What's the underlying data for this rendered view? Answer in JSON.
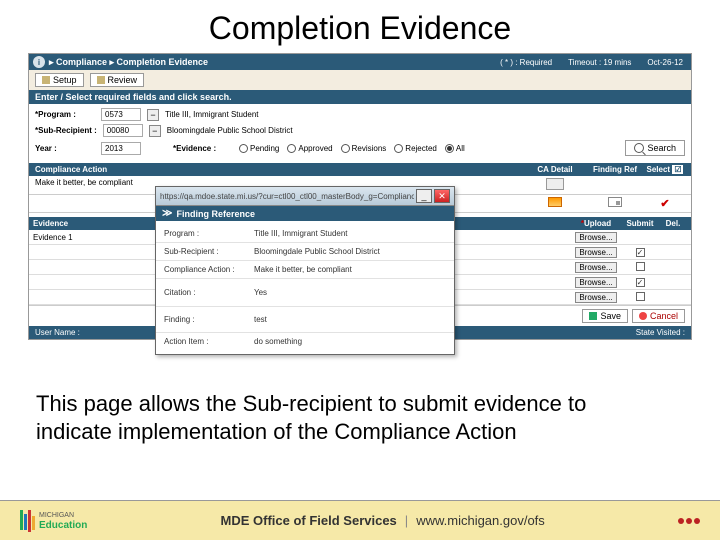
{
  "slide": {
    "title": "Completion Evidence"
  },
  "breadcrumb": {
    "path": "▸ Compliance ▸ Completion Evidence",
    "required_marker": "( * ) : Required",
    "timeout": "Timeout : 19 mins",
    "date": "Oct-26-12"
  },
  "top_buttons": {
    "setup": "Setup",
    "review": "Review"
  },
  "search": {
    "header": "Enter / Select required fields and click search.",
    "program_label": "*Program :",
    "program_code": "0573",
    "program_desc": "Title III, Immigrant Student",
    "sub_label": "*Sub-Recipient :",
    "sub_code": "00080",
    "sub_desc": "Bloomingdale Public School District",
    "year_label": "Year :",
    "year_val": "2013",
    "evidence_label": "*Evidence :",
    "r1": "Pending",
    "r2": "Approved",
    "r3": "Revisions",
    "r4": "Rejected",
    "r5": "All",
    "search_btn": "Search"
  },
  "ca": {
    "h1": "Compliance Action",
    "h2": "CA Detail",
    "h3": "Finding Ref",
    "h4": "Select",
    "row1_text": "Make it better, be compliant"
  },
  "popup": {
    "url": "https://qa.mdoe.state.mi.us/?cur=ctl00_ctl00_masterBody_g=Compliance_ctl...",
    "header": "Finding Reference",
    "program_label": "Program :",
    "program_val": "Title III, Immigrant Student",
    "sub_label": "Sub-Recipient :",
    "sub_val": "Bloomingdale Public School District",
    "ca_label": "Compliance Action :",
    "ca_val": "Make it better, be compliant",
    "citation_label": "Citation :",
    "citation_val": "Yes",
    "finding_label": "Finding :",
    "finding_val": "test",
    "action_label": "Action Item :",
    "action_val": "do something"
  },
  "evidence": {
    "h1": "Evidence",
    "h2": "",
    "h3": "Upload",
    "h4": "Submit",
    "h5": "Del.",
    "row1_label": "Evidence 1",
    "browse": "Browse..."
  },
  "save_cancel": {
    "save": "Save",
    "cancel": "Cancel"
  },
  "footer_bar": {
    "user": "User Name :",
    "visit": "State Visited :"
  },
  "caption": "This page allows the Sub-recipient to submit evidence to indicate implementation of the Compliance Action",
  "slide_footer": {
    "logo_small": "MICHIGAN",
    "logo_big": "Education",
    "center1": "MDE Office of Field Services",
    "center2": "www.michigan.gov/ofs"
  }
}
